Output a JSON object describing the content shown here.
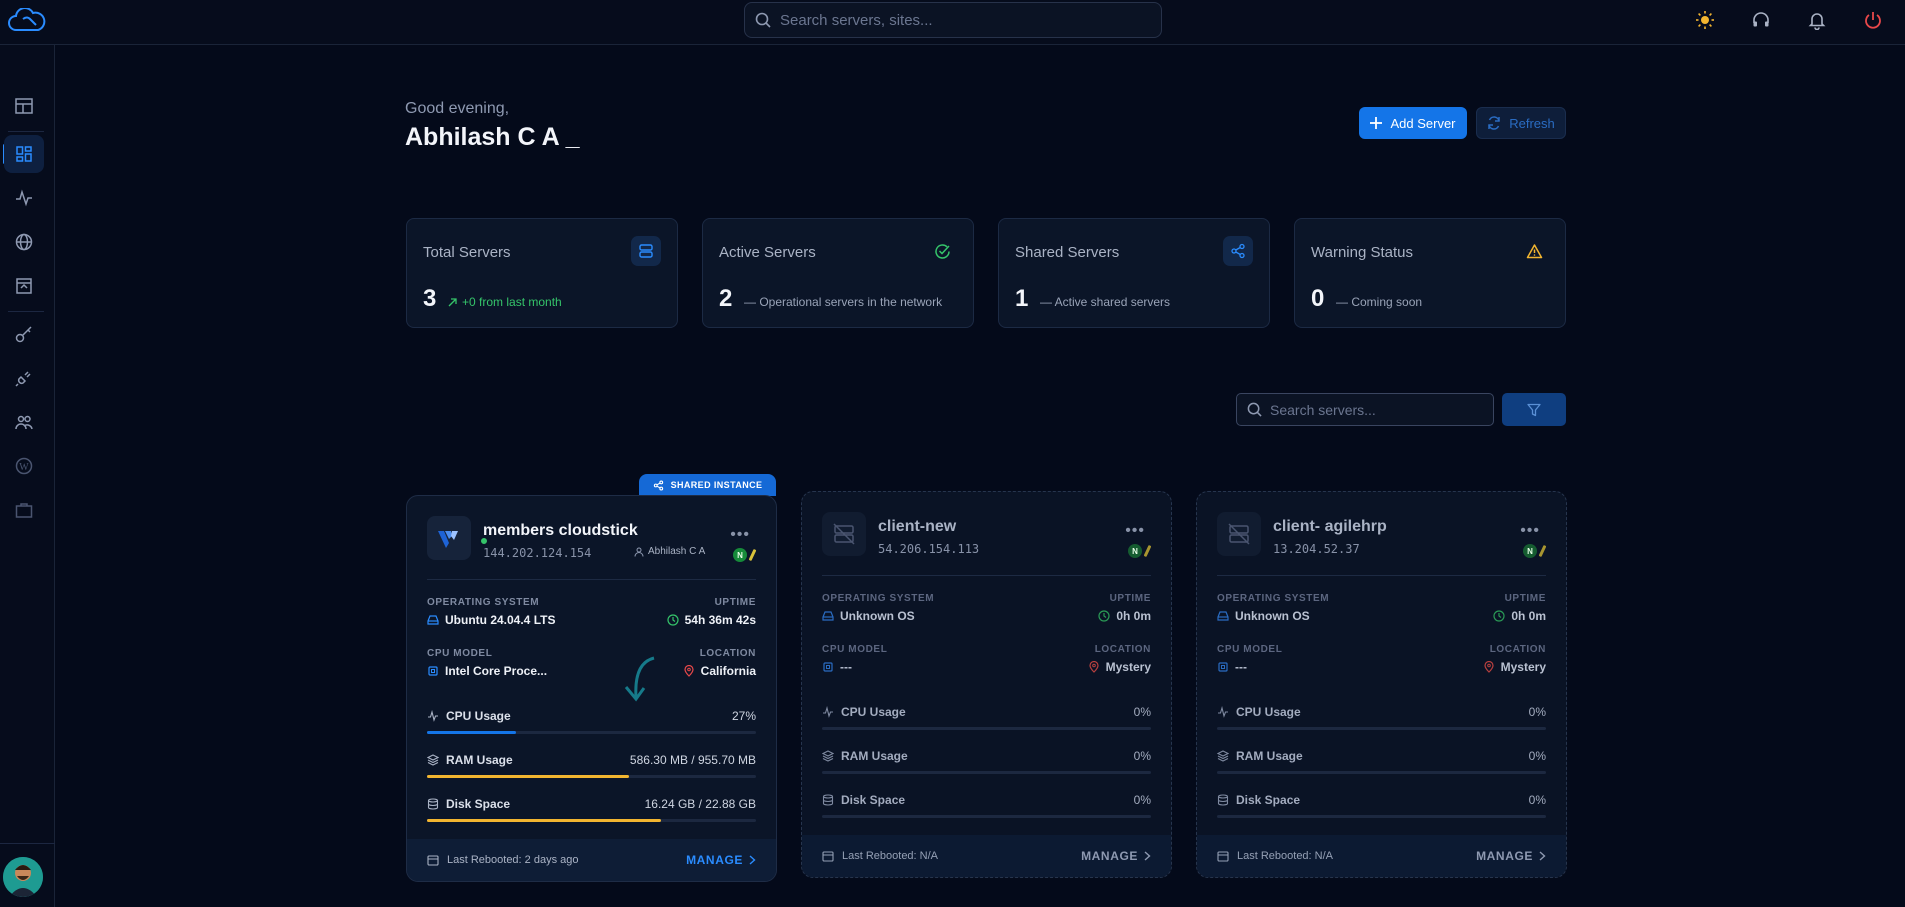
{
  "topbar": {
    "search_placeholder": "Search servers, sites..."
  },
  "header": {
    "greeting": "Good evening,",
    "username": "Abhilash C A _",
    "add_server_label": "Add Server",
    "refresh_label": "Refresh"
  },
  "stats": [
    {
      "title": "Total Servers",
      "value": "3",
      "sub": "+0 from last month",
      "icon": "servers-icon",
      "color": "#2a8cff"
    },
    {
      "title": "Active Servers",
      "value": "2",
      "sub": "— Operational servers in the network",
      "icon": "check-circle-icon",
      "color": "#35c46a"
    },
    {
      "title": "Shared Servers",
      "value": "1",
      "sub": "— Active shared servers",
      "icon": "share-icon",
      "color": "#2a8cff"
    },
    {
      "title": "Warning Status",
      "value": "0",
      "sub": "— Coming soon",
      "icon": "warning-icon",
      "color": "#f2b530"
    }
  ],
  "list": {
    "search_placeholder": "Search servers..."
  },
  "cards": [
    {
      "tag": "SHARED INSTANCE",
      "name": "members cloudstick",
      "ip": "144.202.124.154",
      "owner": "Abhilash C A",
      "os_label": "OPERATING SYSTEM",
      "os": "Ubuntu 24.04.4 LTS",
      "uptime_label": "UPTIME",
      "uptime": "54h 36m 42s",
      "cpu_model_label": "CPU MODEL",
      "cpu_model": "Intel Core Proce...",
      "location_label": "LOCATION",
      "location": "California",
      "cpu_label": "CPU Usage",
      "cpu_value": "27%",
      "cpu_fraction": 0.27,
      "ram_label": "RAM Usage",
      "ram_value": "586.30 MB / 955.70 MB",
      "ram_fraction": 0.613,
      "disk_label": "Disk Space",
      "disk_value": "16.24 GB / 22.88 GB",
      "disk_fraction": 0.71,
      "rebooted": "Last Rebooted: 2 days ago",
      "manage": "MANAGE"
    },
    {
      "name": "client-new",
      "ip": "54.206.154.113",
      "os_label": "OPERATING SYSTEM",
      "os": "Unknown OS",
      "uptime_label": "UPTIME",
      "uptime": "0h 0m",
      "cpu_model_label": "CPU MODEL",
      "cpu_model": "---",
      "location_label": "LOCATION",
      "location": "Mystery",
      "cpu_label": "CPU Usage",
      "cpu_value": "0%",
      "ram_label": "RAM Usage",
      "ram_value": "0%",
      "disk_label": "Disk Space",
      "disk_value": "0%",
      "rebooted": "Last Rebooted: N/A",
      "manage": "MANAGE"
    },
    {
      "name": "client- agilehrp",
      "ip": "13.204.52.37",
      "os_label": "OPERATING SYSTEM",
      "os": "Unknown OS",
      "uptime_label": "UPTIME",
      "uptime": "0h 0m",
      "cpu_model_label": "CPU MODEL",
      "cpu_model": "---",
      "location_label": "LOCATION",
      "location": "Mystery",
      "cpu_label": "CPU Usage",
      "cpu_value": "0%",
      "ram_label": "RAM Usage",
      "ram_value": "0%",
      "disk_label": "Disk Space",
      "disk_value": "0%",
      "rebooted": "Last Rebooted: N/A",
      "manage": "MANAGE"
    }
  ],
  "colors": {
    "accent": "#1475e8",
    "warning": "#f2b530",
    "success": "#35c46a",
    "danger": "#e8484a"
  }
}
